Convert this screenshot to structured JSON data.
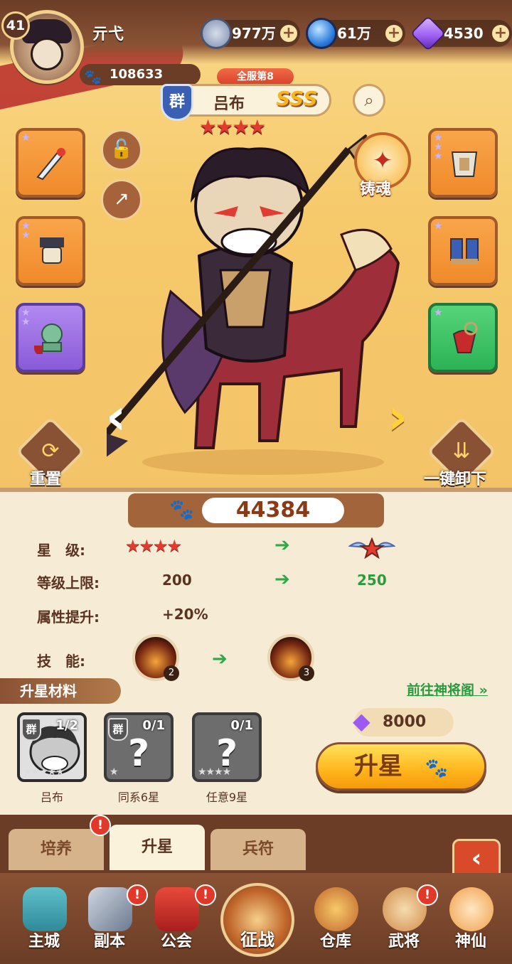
{
  "player": {
    "level": "41",
    "name": "亓弋",
    "power": "108633"
  },
  "resources": [
    {
      "name": "coins",
      "value": "977万",
      "color": "#7b8bb0"
    },
    {
      "name": "orbs",
      "value": "61万",
      "color": "#2f7fe0"
    },
    {
      "name": "gems",
      "value": "4530",
      "color": "#9b5bf2"
    }
  ],
  "hero": {
    "server_rank": "全服第8",
    "faction": "群",
    "name": "吕布",
    "rarity": "SSS",
    "stars": "★★★★",
    "forge_label": "铸魂"
  },
  "actions": {
    "reset_label": "重置",
    "unequip_label": "一键卸下"
  },
  "combat_power": "44384",
  "stats": {
    "star_label": "星　级:",
    "cap_label": "等级上限:",
    "cap_current": "200",
    "cap_next": "250",
    "attr_label": "属性提升:",
    "attr_value": "+20%",
    "skill_label": "技　能:",
    "skill_current": "2",
    "skill_next": "3"
  },
  "materials": {
    "title": "升星材料",
    "goto_link": "前往神将阁",
    "items": [
      {
        "name": "吕布",
        "count": "1/2",
        "faction": "群"
      },
      {
        "name": "同系6星",
        "count": "0/1",
        "faction": "群"
      },
      {
        "name": "任意9星",
        "count": "0/1",
        "faction": ""
      }
    ]
  },
  "cost": "8000",
  "upgrade_label": "升星",
  "tabs": [
    {
      "label": "培养"
    },
    {
      "label": "升星"
    },
    {
      "label": "兵符"
    }
  ],
  "nav": [
    {
      "label": "主城"
    },
    {
      "label": "副本"
    },
    {
      "label": "公会"
    },
    {
      "label": "征战"
    },
    {
      "label": "仓库"
    },
    {
      "label": "武将"
    },
    {
      "label": "神仙"
    }
  ],
  "badge_symbol": "!"
}
